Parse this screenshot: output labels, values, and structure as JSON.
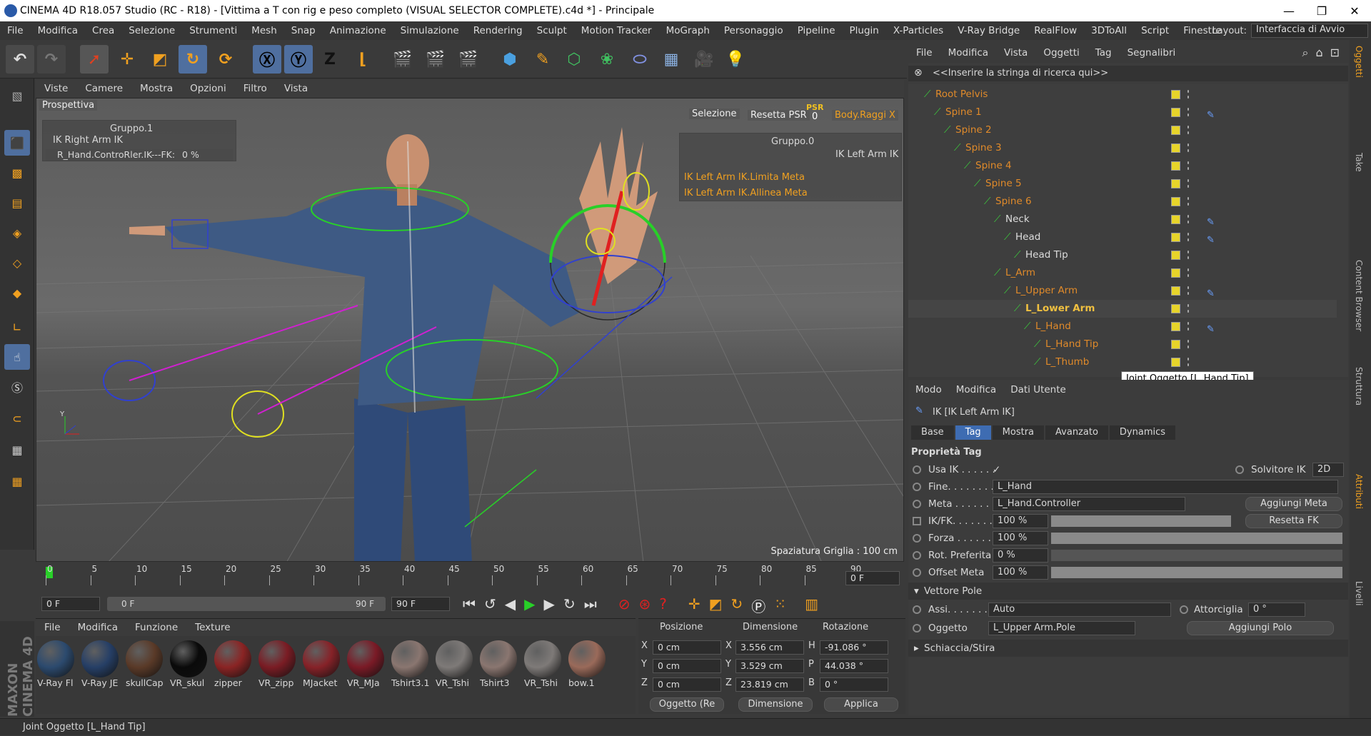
{
  "window": {
    "title": "CINEMA 4D R18.057 Studio (RC - R18) - [Vittima a T con rig e peso completo (VISUAL SELECTOR COMPLETE).c4d *] - Principale",
    "min": "—",
    "max": "❐",
    "close": "✕"
  },
  "menubar": {
    "items": [
      "File",
      "Modifica",
      "Crea",
      "Selezione",
      "Strumenti",
      "Mesh",
      "Snap",
      "Animazione",
      "Simulazione",
      "Rendering",
      "Sculpt",
      "Motion Tracker",
      "MoGraph",
      "Personaggio",
      "Pipeline",
      "Plugin",
      "X-Particles",
      "V-Ray Bridge",
      "RealFlow",
      "3DToAll",
      "Script",
      "Finestre"
    ],
    "layout_label": "Layout:",
    "layout_value": "Interfaccia di Avvio"
  },
  "viewport": {
    "menu": [
      "Viste",
      "Camere",
      "Mostra",
      "Opzioni",
      "Filtro",
      "Vista"
    ],
    "camera": "Prospettiva",
    "group1": "Gruppo.1",
    "ik_right": "IK Right Arm IK",
    "rhand": "R_Hand.ControRler.IK---FK:",
    "rhand_val": "0 %",
    "selezione": "Selezione",
    "resetta": "Resetta PSR",
    "psr": "PSR",
    "psr_val": "0",
    "body_rays": "Body.Raggi X",
    "group0": "Gruppo.0",
    "ik_left": "IK Left Arm IK",
    "limita": "IK Left Arm IK.Limita Meta",
    "allinea": "IK Left Arm IK.Allinea Meta",
    "grid": "Spaziatura Griglia : 100 cm"
  },
  "timeline": {
    "ticks": [
      "0",
      "5",
      "10",
      "15",
      "20",
      "25",
      "30",
      "35",
      "40",
      "45",
      "50",
      "55",
      "60",
      "65",
      "70",
      "75",
      "80",
      "85",
      "90"
    ],
    "current": "0 F"
  },
  "transport": {
    "start": "0 F",
    "range_start": "0 F",
    "range_end": "90 F",
    "end": "90 F"
  },
  "materials": {
    "menu": [
      "File",
      "Modifica",
      "Funzione",
      "Texture"
    ],
    "items": [
      {
        "name": "V-Ray Fl",
        "color": "#2c4a6e"
      },
      {
        "name": "V-Ray JE",
        "color": "#263f66"
      },
      {
        "name": "skullCap",
        "color": "#5a3a28"
      },
      {
        "name": "VR_skul",
        "color": "#0a0a0a"
      },
      {
        "name": "zipper",
        "color": "#8a2424"
      },
      {
        "name": "VR_zipp",
        "color": "#7a1c24"
      },
      {
        "name": "MJacket",
        "color": "#862228"
      },
      {
        "name": "VR_MJa",
        "color": "#7a1a26"
      },
      {
        "name": "Tshirt3.1",
        "color": "#8a7670"
      },
      {
        "name": "VR_Tshi",
        "color": "#7e7a78"
      },
      {
        "name": "Tshirt3",
        "color": "#8a7670"
      },
      {
        "name": "VR_Tshi",
        "color": "#7e7a78"
      },
      {
        "name": "bow.1",
        "color": "#9a6a5a"
      }
    ]
  },
  "coords": {
    "h_pos": "Posizione",
    "h_dim": "Dimensione",
    "h_rot": "Rotazione",
    "rows": [
      {
        "a": "X",
        "p": "0 cm",
        "b": "X",
        "d": "3.556 cm",
        "c": "H",
        "r": "-91.086 °"
      },
      {
        "a": "Y",
        "p": "0 cm",
        "b": "Y",
        "d": "3.529 cm",
        "c": "P",
        "r": "44.038 °"
      },
      {
        "a": "Z",
        "p": "0 cm",
        "b": "Z",
        "d": "23.819 cm",
        "c": "B",
        "r": "0 °"
      }
    ],
    "mode": "Oggetto (Re",
    "dim": "Dimensione",
    "apply": "Applica"
  },
  "objmgr": {
    "menu": [
      "File",
      "Modifica",
      "Vista",
      "Oggetti",
      "Tag",
      "Segnalibri"
    ],
    "search": "<<Inserire la stringa di ricerca qui>>",
    "tree": [
      {
        "name": "Root Pelvis",
        "d": 0,
        "color": "#e08a2a"
      },
      {
        "name": "Spine 1",
        "d": 1,
        "color": "#e08a2a",
        "tag": true
      },
      {
        "name": "Spine 2",
        "d": 2,
        "color": "#e08a2a"
      },
      {
        "name": "Spine 3",
        "d": 3,
        "color": "#e08a2a"
      },
      {
        "name": "Spine 4",
        "d": 4,
        "color": "#e08a2a"
      },
      {
        "name": "Spine 5",
        "d": 5,
        "color": "#e08a2a"
      },
      {
        "name": "Spine 6",
        "d": 6,
        "color": "#e08a2a"
      },
      {
        "name": "Neck",
        "d": 7,
        "color": "#ddd",
        "tag": true
      },
      {
        "name": "Head",
        "d": 8,
        "color": "#ddd",
        "tag": true
      },
      {
        "name": "Head Tip",
        "d": 9,
        "color": "#ddd"
      },
      {
        "name": "L_Arm",
        "d": 7,
        "color": "#e08a2a"
      },
      {
        "name": "L_Upper Arm",
        "d": 8,
        "color": "#e08a2a",
        "tag": true
      },
      {
        "name": "L_Lower Arm",
        "d": 9,
        "color": "#f0c040"
      },
      {
        "name": "L_Hand",
        "d": 10,
        "color": "#e08a2a",
        "tag": true
      },
      {
        "name": "L_Hand Tip",
        "d": 11,
        "color": "#e08a2a"
      },
      {
        "name": "L_Thumb",
        "d": 11,
        "color": "#e08a2a"
      }
    ]
  },
  "tooltip": "Joint Oggetto [L_Hand Tip]",
  "attr": {
    "menu": [
      "Modo",
      "Modifica",
      "Dati Utente"
    ],
    "object": "IK [IK Left Arm IK]",
    "tabs": [
      "Base",
      "Tag",
      "Mostra",
      "Avanzato",
      "Dynamics"
    ],
    "section": "Proprietà Tag",
    "use_ik": "Usa IK . . . . . .",
    "use_ik_val": "✓",
    "solver": "Solvitore IK",
    "solver_val": "2D",
    "fine": "Fine. . . . . . . .",
    "fine_val": "L_Hand",
    "meta": "Meta . . . . . . .",
    "meta_val": "L_Hand.Controller",
    "add_meta": "Aggiungi Meta",
    "ikfk": "IK/FK. . . . . . .",
    "ikfk_val": "100 %",
    "reset_fk": "Resetta FK",
    "ikfk_fraction": 1.0,
    "forza": "Forza . . . . . .",
    "forza_val": "100 %",
    "forza_fraction": 1.0,
    "rot": "Rot. Preferita",
    "rot_val": "0 %",
    "rot_fraction": 0,
    "offset": "Offset Meta",
    "offset_val": "100 %",
    "offset_fraction": 1.0,
    "pole_section": "Vettore Pole",
    "assi": "Assi. . . . . . . .",
    "assi_val": "Auto",
    "twist": "Attorciglia",
    "twist_val": "0 °",
    "oggetto": "Oggetto",
    "oggetto_val": "L_Upper Arm.Pole",
    "add_pole": "Aggiungi Polo",
    "squash": "Schiaccia/Stira"
  },
  "status": "Joint Oggetto [L_Hand Tip]",
  "side_tabs": [
    "Oggetti",
    "Take",
    "Content Browser",
    "Struttura",
    "Attributi",
    "Livelli"
  ],
  "maxon": "MAXON CINEMA 4D"
}
